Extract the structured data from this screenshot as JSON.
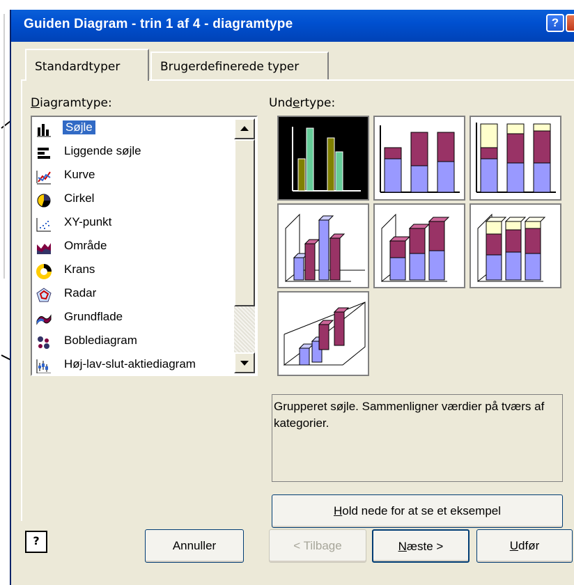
{
  "window": {
    "title": "Guiden Diagram - trin 1 af 4 - diagramtype",
    "help_glyph": "?"
  },
  "tabs": [
    {
      "label": "Standardtyper",
      "selected": true
    },
    {
      "label": "Brugerdefinerede typer",
      "selected": false
    }
  ],
  "chart_type_label": {
    "before": "",
    "accel": "D",
    "after": "iagramtype:"
  },
  "subtype_label": {
    "before": "Und",
    "accel": "e",
    "after": "rtype:"
  },
  "chart_types": [
    {
      "label": "Søjle",
      "icon": "column-chart-icon",
      "selected": true
    },
    {
      "label": "Liggende søjle",
      "icon": "bar-chart-icon"
    },
    {
      "label": "Kurve",
      "icon": "line-chart-icon"
    },
    {
      "label": "Cirkel",
      "icon": "pie-chart-icon"
    },
    {
      "label": "XY-punkt",
      "icon": "scatter-chart-icon"
    },
    {
      "label": "Område",
      "icon": "area-chart-icon"
    },
    {
      "label": "Krans",
      "icon": "doughnut-chart-icon"
    },
    {
      "label": "Radar",
      "icon": "radar-chart-icon"
    },
    {
      "label": "Grundflade",
      "icon": "surface-chart-icon"
    },
    {
      "label": "Boblediagram",
      "icon": "bubble-chart-icon"
    },
    {
      "label": "Høj-lav-slut-aktiediagram",
      "icon": "stock-chart-icon"
    }
  ],
  "description": "Grupperet søjle. Sammenligner værdier på tværs af kategorier.",
  "buttons": {
    "hold": {
      "accel": "H",
      "rest": "old nede for at se et eksempel"
    },
    "cancel": "Annuller",
    "back": "< Tilbage",
    "next": {
      "accel": "N",
      "rest": "æste >"
    },
    "finish": {
      "accel": "U",
      "rest": "dfør"
    },
    "help_glyph": "?"
  },
  "colors": {
    "title_bar": "#0050d0",
    "selection": "#316ac5",
    "bar_purple": "#993366",
    "bar_lilac": "#9999ff",
    "bar_cream": "#ffffcc",
    "bar_olive": "#808000",
    "bar_teal": "#66cc99"
  }
}
